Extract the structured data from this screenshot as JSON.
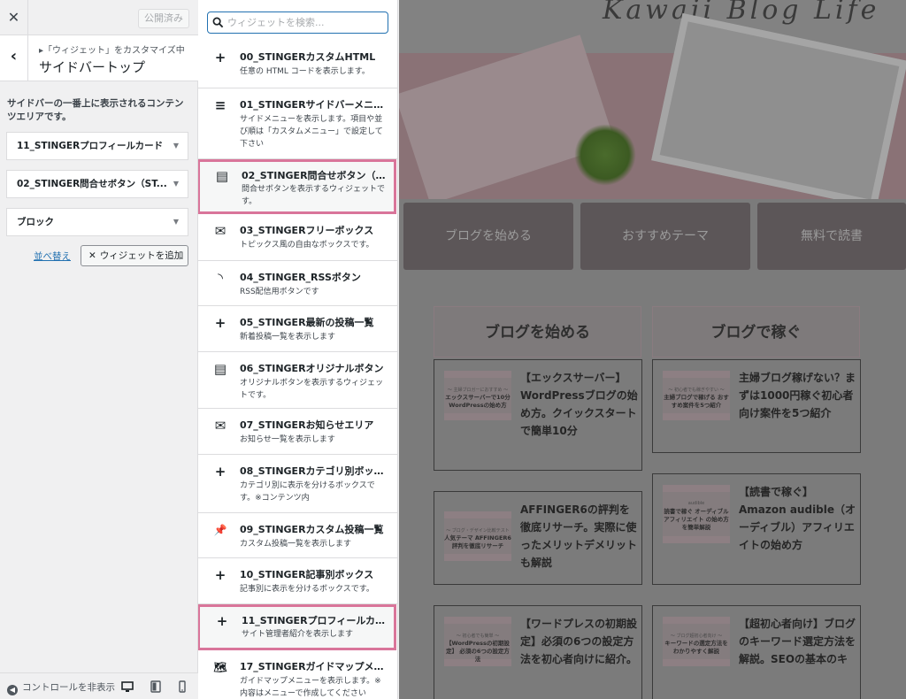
{
  "customizer": {
    "close_label": "✕",
    "publish_label": "公開済み",
    "back_label": "‹",
    "breadcrumb": "▸「ウィジェット」をカスタマイズ中",
    "section_title": "サイドバートップ",
    "area_description": "サイドバーの一番上に表示されるコンテンツエリアです。",
    "area_widgets": [
      {
        "label": "11_STINGERプロフィールカード"
      },
      {
        "label": "02_STINGER問合せボタン（ST..."
      },
      {
        "label": "ブロック"
      }
    ],
    "reorder_label": "並べ替え",
    "add_widget_label": "ウィジェットを追加",
    "footer": {
      "hide_controls_label": "コントロールを非表示"
    }
  },
  "widgets_panel": {
    "search_placeholder": "ウィジェットを検索...",
    "items": [
      {
        "icon": "plus-icon",
        "glyph": "+",
        "title": "00_STINGERカスタムHTML",
        "desc": "任意の HTML コードを表示します。"
      },
      {
        "icon": "menu-icon",
        "glyph": "≡",
        "title": "01_STINGERサイドバーメニュー",
        "desc": "サイドメニューを表示します。項目や並び順は「カスタムメニュー」で設定して下さい"
      },
      {
        "icon": "contact-card-icon",
        "glyph": "▤",
        "title": "02_STINGER問合せボタン（ST...",
        "desc": "問合せボタンを表示するウィジェットです。"
      },
      {
        "icon": "envelope-icon",
        "glyph": "✉",
        "title": "03_STINGERフリーボックス",
        "desc": "トピックス風の自由なボックスです。"
      },
      {
        "icon": "rss-icon",
        "glyph": "◝",
        "title": "04_STINGER_RSSボタン",
        "desc": "RSS配信用ボタンです"
      },
      {
        "icon": "plus-icon",
        "glyph": "+",
        "title": "05_STINGER最新の投稿一覧",
        "desc": "新着投稿一覧を表示します"
      },
      {
        "icon": "contact-card-icon",
        "glyph": "▤",
        "title": "06_STINGERオリジナルボタン",
        "desc": "オリジナルボタンを表示するウィジェットです。"
      },
      {
        "icon": "envelope-icon",
        "glyph": "✉",
        "title": "07_STINGERお知らせエリア",
        "desc": "お知らせ一覧を表示します"
      },
      {
        "icon": "plus-icon",
        "glyph": "+",
        "title": "08_STINGERカテゴリ別ボックス",
        "desc": "カテゴリ別に表示を分けるボックスです。※コンテンツ内"
      },
      {
        "icon": "pin-icon",
        "glyph": "📌",
        "title": "09_STINGERカスタム投稿一覧",
        "desc": "カスタム投稿一覧を表示します"
      },
      {
        "icon": "plus-icon",
        "glyph": "+",
        "title": "10_STINGER記事別ボックス",
        "desc": "記事別に表示を分けるボックスです。"
      },
      {
        "icon": "plus-icon",
        "glyph": "+",
        "title": "11_STINGERプロフィールカード",
        "desc": "サイト管理者紹介を表示します"
      },
      {
        "icon": "map-icon",
        "glyph": "🗺",
        "title": "17_STINGERガイドマップメニュ...",
        "desc": "ガイドマップメニューを表示します。※内容はメニューで作成してください"
      }
    ]
  },
  "preview": {
    "hero_script": "Kawaii Blog Life",
    "categories": [
      "ブログを始める",
      "おすすめテーマ",
      "無料で読書"
    ],
    "columns": [
      {
        "heading": "ブログを始める",
        "posts": [
          {
            "thumb_small": "〜 主婦ブロガーにおすすめ 〜",
            "thumb_big": "エックスサーバーで10分 WordPressの始め方",
            "title": "【エックスサーバー】WordPressブログの始め方。クイックスタートで簡単10分"
          },
          {
            "thumb_small": "〜 ブログ・デザイン比較テスト 〜",
            "thumb_big": "人気テーマ AFFINGER6 評判を徹底リサーチ",
            "title": "AFFINGER6の評判を徹底リサーチ。実際に使ったメリットデメリットも解説"
          },
          {
            "thumb_small": "〜 初心者でも簡単 〜",
            "thumb_big": "【WordPressの初期設定】 必須の6つの設定方法",
            "title": "【ワードプレスの初期設定】必須の6つの設定方法を初心者向けに紹介。"
          }
        ]
      },
      {
        "heading": "ブログで稼ぐ",
        "posts": [
          {
            "thumb_small": "〜 初心者でも稼ぎやすい 〜",
            "thumb_big": "主婦ブログで稼げる おすすめ案件を5つ紹介",
            "title": "主婦ブログ稼げない？まずは1000円稼ぐ初心者向け案件を5つ紹介"
          },
          {
            "thumb_small": "audible",
            "thumb_big": "読書で稼ぐ オーディブルアフィリエイト の始め方を簡単解説",
            "title": "【読書で稼ぐ】Amazon audible（オーディブル）アフィリエイトの始め方"
          },
          {
            "thumb_small": "〜 ブログ超初心者向け 〜",
            "thumb_big": "キーワードの選定方法を わかりやすく解説",
            "title": "【超初心者向け】ブログのキーワード選定方法を解説。SEOの基本のキ"
          }
        ]
      }
    ]
  },
  "colors": {
    "highlight": "#d9759a",
    "link": "#2271b1",
    "overlay": "#7b7b7b"
  }
}
